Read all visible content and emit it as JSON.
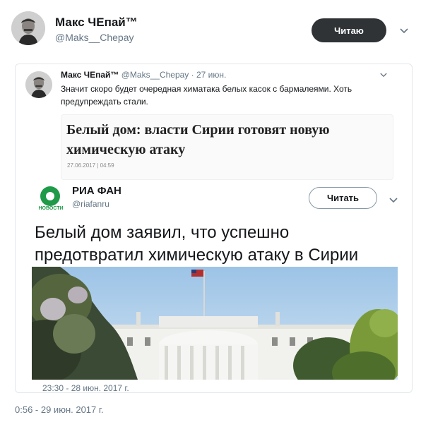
{
  "outer": {
    "name": "Макс ЧЕпай™",
    "handle": "@Maks__Chepay",
    "follow_label": "Читаю",
    "timestamp": "0:56 - 29 июн. 2017 г."
  },
  "quoted": {
    "name": "Макс ЧЕпай™",
    "handle": "@Maks__Chepay",
    "date": "· 27 июн.",
    "text": "Значит скоро будет очередная химатака белых касок с бармалеями. Хоть предупреждать стали."
  },
  "article": {
    "title": "Белый дом: власти Сирии готовят новую химическую атаку",
    "date": "27.06.2017 | 04:59"
  },
  "ria": {
    "logo_text": "НОВОСТИ",
    "name": "РИА ФАН",
    "handle": "@riafanru",
    "follow_label": "Читать",
    "text": "Белый дом заявил, что успешно предотвратил химическую атаку в Сирии",
    "timestamp": "23:30 - 28 июн. 2017 г."
  },
  "icons": {
    "chevron": "chevron-down-icon"
  },
  "colors": {
    "follow_dark": "#2f3336",
    "ria_green": "#1f9a49",
    "muted": "#657786"
  }
}
